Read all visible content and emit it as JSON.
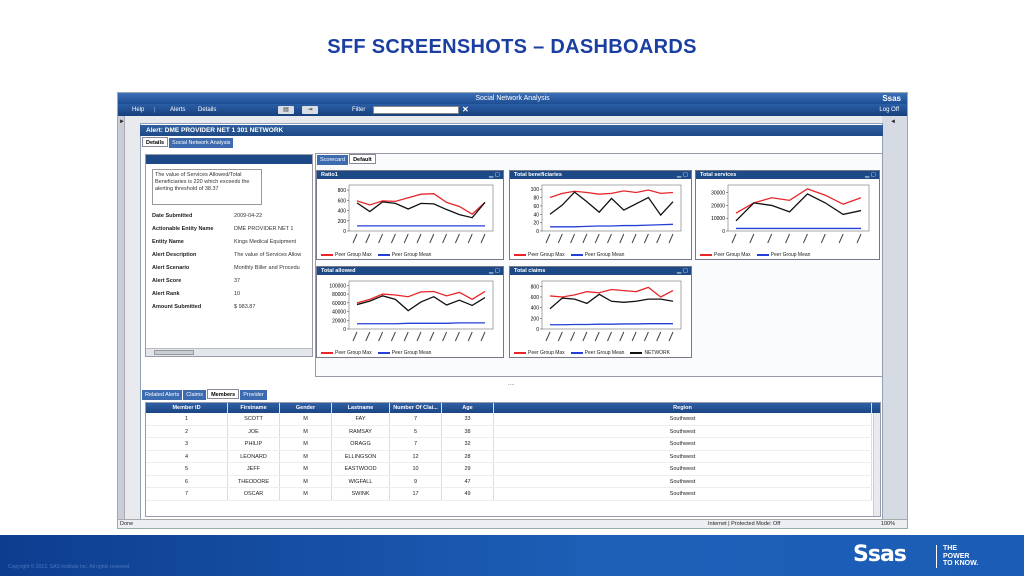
{
  "slide_title": "SFF SCREENSHOTS – DASHBOARDS",
  "window_title": "Social Network Analysis",
  "brand": "Ssas",
  "menu": {
    "help": "Help",
    "alerts": "Alerts",
    "details": "Details",
    "filter": "Filter",
    "logoff": "Log Off",
    "clear": "✕"
  },
  "alert_header": "Alert: DME PROVIDER NET 1 301 NETWORK",
  "top_tabs": [
    "Details",
    "Social Network Analysis"
  ],
  "message": "The value of Services Allowed/Total Beneficiaries is 220 which exceeds the alerting threshold of 38.37",
  "fields": [
    {
      "k": "Date Submitted",
      "v": "2009-04-22"
    },
    {
      "k": "Actionable Entity Name",
      "v": "DME PROVIDER NET 1"
    },
    {
      "k": "Entity Name",
      "v": "Kings Medical Equipment"
    },
    {
      "k": "Alert Description",
      "v": "The value of Services Allow"
    },
    {
      "k": "Alert Scenario",
      "v": "Monthly Biller and Procedu"
    },
    {
      "k": "Alert Score",
      "v": "37"
    },
    {
      "k": "Alert Rank",
      "v": "10"
    },
    {
      "k": "Amount Submitted",
      "v": "$ 983.87"
    }
  ],
  "sub_tabs": [
    "Scorecard",
    "Default"
  ],
  "grip": "....",
  "legend": {
    "max": "Peer Group Max",
    "mean": "Peer Group Mean",
    "network": "NETWORK"
  },
  "colors": {
    "max": "#e8262a",
    "mean": "#2340d8",
    "network": "#111111",
    "header": "#1d4a86"
  },
  "chart_data": [
    {
      "type": "line",
      "title": "Ratio1",
      "ylim": [
        0,
        900
      ],
      "yticks": [
        "800",
        "600",
        "400",
        "200",
        "0"
      ],
      "yvals": [
        800,
        600,
        400,
        200,
        0
      ],
      "series": [
        {
          "name": "Peer Group Max",
          "values": [
            590,
            510,
            590,
            580,
            650,
            720,
            730,
            560,
            480,
            330,
            560
          ]
        },
        {
          "name": "Peer Group Mean",
          "values": [
            100,
            100,
            100,
            100,
            100,
            100,
            100,
            100,
            100,
            100,
            100
          ]
        },
        {
          "name": "NETWORK",
          "values": [
            550,
            380,
            570,
            540,
            430,
            540,
            530,
            420,
            320,
            260,
            560
          ]
        }
      ]
    },
    {
      "type": "line",
      "title": "Total beneficiaries",
      "ylim": [
        0,
        110
      ],
      "yticks": [
        "100",
        "80",
        "60",
        "40",
        "20",
        "0"
      ],
      "yvals": [
        100,
        80,
        60,
        40,
        20,
        0
      ],
      "series": [
        {
          "name": "Peer Group Max",
          "values": [
            80,
            90,
            95,
            92,
            88,
            90,
            96,
            92,
            98,
            90,
            92
          ]
        },
        {
          "name": "Peer Group Mean",
          "values": [
            10,
            10,
            10,
            11,
            12,
            12,
            13,
            13,
            14,
            15,
            16
          ]
        },
        {
          "name": "NETWORK",
          "values": [
            40,
            62,
            93,
            70,
            45,
            78,
            50,
            65,
            80,
            38,
            70
          ]
        }
      ]
    },
    {
      "type": "line",
      "title": "Total services",
      "ylim": [
        0,
        36000
      ],
      "yticks": [
        "30000",
        "20000",
        "10000",
        "0"
      ],
      "yvals": [
        30000,
        20000,
        10000,
        0
      ],
      "series": [
        {
          "name": "Peer Group Max",
          "values": [
            14000,
            22000,
            26000,
            24000,
            33000,
            28000,
            21000,
            26000
          ]
        },
        {
          "name": "Peer Group Mean",
          "values": [
            2000,
            2000,
            2000,
            2000,
            2000,
            2000,
            2000,
            2000
          ]
        },
        {
          "name": "NETWORK",
          "values": [
            8000,
            22000,
            20000,
            15000,
            29000,
            22000,
            13000,
            16000
          ]
        }
      ]
    },
    {
      "type": "line",
      "title": "Total allowed",
      "ylim": [
        0,
        110000
      ],
      "yticks": [
        "100000",
        "80000",
        "60000",
        "40000",
        "20000",
        "0"
      ],
      "yvals": [
        100000,
        80000,
        60000,
        40000,
        20000,
        0
      ],
      "series": [
        {
          "name": "Peer Group Max",
          "values": [
            60000,
            68000,
            80000,
            78000,
            74000,
            85000,
            86000,
            76000,
            84000,
            68000,
            86000
          ]
        },
        {
          "name": "Peer Group Mean",
          "values": [
            12000,
            12000,
            12000,
            12000,
            13000,
            13000,
            13000,
            13000,
            14000,
            14000,
            14000
          ]
        },
        {
          "name": "NETWORK",
          "values": [
            56000,
            64000,
            76000,
            68000,
            42000,
            62000,
            74000,
            55000,
            66000,
            54000,
            72000
          ]
        }
      ]
    },
    {
      "type": "line",
      "title": "Total claims",
      "ylim": [
        0,
        900
      ],
      "yticks": [
        "800",
        "600",
        "400",
        "200",
        "0"
      ],
      "yvals": [
        800,
        600,
        400,
        200,
        0
      ],
      "series": [
        {
          "name": "Peer Group Max",
          "values": [
            620,
            600,
            640,
            700,
            680,
            740,
            720,
            700,
            780,
            600,
            720
          ]
        },
        {
          "name": "Peer Group Mean",
          "values": [
            80,
            80,
            85,
            85,
            90,
            90,
            95,
            95,
            100,
            100,
            100
          ]
        },
        {
          "name": "NETWORK",
          "values": [
            380,
            580,
            560,
            480,
            650,
            520,
            500,
            520,
            560,
            560,
            520
          ]
        }
      ]
    }
  ],
  "bottom_tabs": [
    "Related Alerts",
    "Claims",
    "Members",
    "Provider"
  ],
  "table": {
    "headers": [
      "Member ID",
      "Firstname",
      "Gender",
      "Lastname",
      "Number Of Clai...",
      "Age",
      "Region"
    ],
    "rows": [
      [
        "1",
        "SCOTT",
        "M",
        "FAY",
        "7",
        "33",
        "Southwest"
      ],
      [
        "2",
        "JOE",
        "M",
        "RAMSAY",
        "5",
        "38",
        "Southwest"
      ],
      [
        "3",
        "PHILIP",
        "M",
        "ORAGG",
        "7",
        "32",
        "Southwest"
      ],
      [
        "4",
        "LEONARD",
        "M",
        "ELLINGSON",
        "12",
        "28",
        "Southwest"
      ],
      [
        "5",
        "JEFF",
        "M",
        "EASTWOOD",
        "10",
        "29",
        "Southwest"
      ],
      [
        "6",
        "THEODORE",
        "M",
        "WIGFALL",
        "9",
        "47",
        "Southwest"
      ],
      [
        "7",
        "OSCAR",
        "M",
        "SWINK",
        "17",
        "49",
        "Southwest"
      ]
    ]
  },
  "status": {
    "left": "Done",
    "ie": "Internet | Protected Mode: Off",
    "zoom": "100%"
  },
  "footer": {
    "copy": "Copyright © 2012, SAS Institute Inc. All rights reserved.",
    "logo": "Ssas",
    "tag1": "THE",
    "tag2": "POWER",
    "tag3": "TO KNOW."
  }
}
